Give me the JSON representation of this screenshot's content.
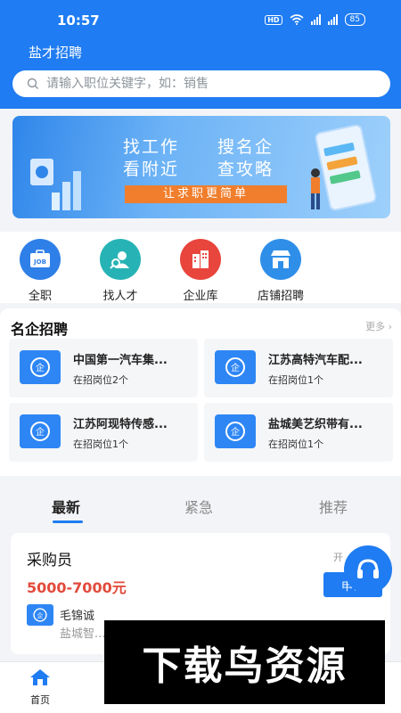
{
  "status_bar": {
    "time": "10:57",
    "hd": "HD",
    "battery": "85"
  },
  "app": {
    "title": "盐才招聘"
  },
  "search": {
    "placeholder": "请输入职位关键字，如：销售"
  },
  "banner": {
    "line1_left": "找工作",
    "line1_right": "搜名企",
    "line2_left": "看附近",
    "line2_right": "查攻略",
    "cta": "让求职更简单"
  },
  "categories": [
    {
      "label": "全职",
      "icon": "job-icon",
      "color": "#2f7fe8"
    },
    {
      "label": "找人才",
      "icon": "talent-search-icon",
      "color": "#27b3b5"
    },
    {
      "label": "企业库",
      "icon": "building-icon",
      "color": "#e8453c"
    },
    {
      "label": "店铺招聘",
      "icon": "shop-icon",
      "color": "#2f8fe8"
    }
  ],
  "famous": {
    "title": "名企招聘",
    "more": "更多",
    "companies": [
      {
        "name": "中国第一汽车集...",
        "count": "在招岗位2个"
      },
      {
        "name": "江苏高特汽车配...",
        "count": "在招岗位1个"
      },
      {
        "name": "江苏阿现特传感...",
        "count": "在招岗位1个"
      },
      {
        "name": "盐城美艺织带有...",
        "count": "在招岗位1个"
      }
    ]
  },
  "tabs": {
    "latest": "最新",
    "urgent": "紧急",
    "recommend": "推荐"
  },
  "job": {
    "title": "采购员",
    "salary": "5000-7000元",
    "tag": "开",
    "apply": "申请",
    "person": "毛锦诚",
    "company": "盐城智..."
  },
  "bottom_nav": {
    "home": "首页"
  },
  "watermark": "下载鸟资源",
  "colors": {
    "primary": "#1f7cf2",
    "salary": "#e24a3b",
    "cta": "#f07e2c"
  }
}
